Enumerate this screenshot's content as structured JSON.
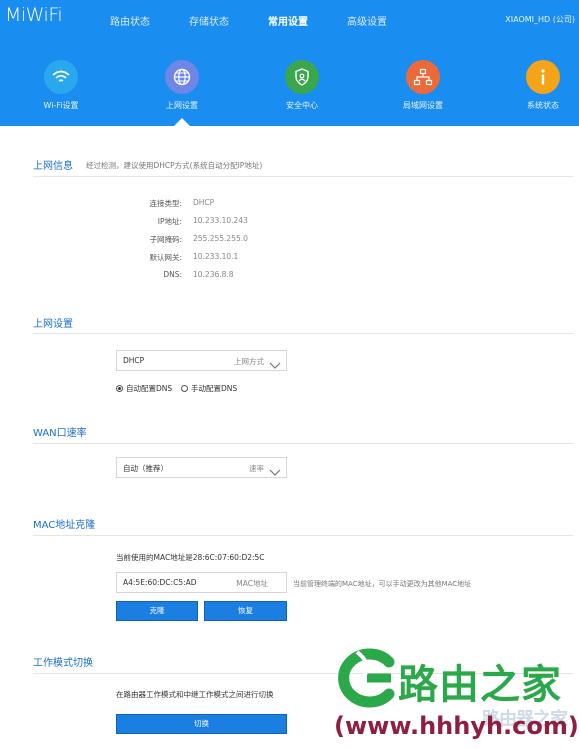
{
  "header": {
    "logo": "MiWiFi",
    "nav": [
      "路由状态",
      "存储状态",
      "常用设置",
      "高级设置"
    ],
    "active_nav": "常用设置",
    "user": "XIAOMI_HD (公司)"
  },
  "subnav": {
    "items": [
      {
        "label": "Wi-Fi设置",
        "icon": "wifi-icon",
        "color": "#2aa8ee"
      },
      {
        "label": "上网设置",
        "icon": "globe-icon",
        "color": "#6f86e6"
      },
      {
        "label": "安全中心",
        "icon": "shield-icon",
        "color": "#3aa74f"
      },
      {
        "label": "局域网设置",
        "icon": "lan-icon",
        "color": "#ec6a3a"
      },
      {
        "label": "系统状态",
        "icon": "info-icon",
        "color": "#f4a418"
      }
    ],
    "active": "上网设置"
  },
  "internet_info": {
    "title": "上网信息",
    "note": "经过检测，建议使用DHCP方式(系统自动分配IP地址)",
    "rows": [
      {
        "label": "连接类型:",
        "value": "DHCP"
      },
      {
        "label": "IP地址:",
        "value": "10.233.10.243"
      },
      {
        "label": "子网掩码:",
        "value": "255.255.255.0"
      },
      {
        "label": "默认网关:",
        "value": "10.233.10.1"
      },
      {
        "label": "DNS:",
        "value": "10.236.8.8"
      }
    ]
  },
  "internet_settings": {
    "title": "上网设置",
    "select_value": "DHCP",
    "select_hint": "上网方式",
    "dns_auto": "自动配置DNS",
    "dns_manual": "手动配置DNS",
    "dns_selected": "auto"
  },
  "wan_speed": {
    "title": "WAN口速率",
    "select_value": "自动（推荐）",
    "select_hint": "速率"
  },
  "mac_clone": {
    "title": "MAC地址克隆",
    "current": "当前使用的MAC地址是28:6C:07:60:D2:5C",
    "input_value": "A4:5E:60:DC:C5:AD",
    "input_hint": "MAC地址",
    "note": "当前管理终端的MAC地址，可以手动更改为其他MAC地址",
    "clone_button": "克隆",
    "restore_button": "恢复"
  },
  "work_mode": {
    "title": "工作模式切换",
    "description": "在路由器工作模式和中继工作模式之间进行切换",
    "switch_button": "切换"
  },
  "watermark": {
    "title": "路由之家",
    "url": "(www.hhhyh.com)",
    "small": "路由器之家"
  }
}
